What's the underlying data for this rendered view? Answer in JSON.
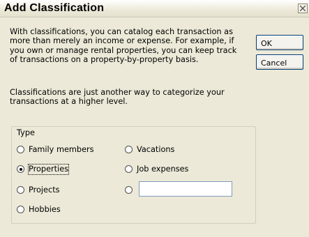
{
  "window": {
    "title": "Add Classification"
  },
  "intro_text": "With classifications, you can catalog each transaction as more than merely an income or expense. For example, if you own or manage rental properties, you can keep track of transactions on a property-by-property basis.",
  "secondary_text": "Classifications are just another way to categorize your transactions at a higher level.",
  "buttons": {
    "ok": "OK",
    "cancel": "Cancel"
  },
  "type_group": {
    "legend": "Type",
    "options": {
      "family_members": "Family members",
      "vacations": "Vacations",
      "properties": "Properties",
      "job_expenses": "Job expenses",
      "projects": "Projects",
      "hobbies": "Hobbies",
      "other_value": ""
    },
    "selected": "Properties"
  }
}
